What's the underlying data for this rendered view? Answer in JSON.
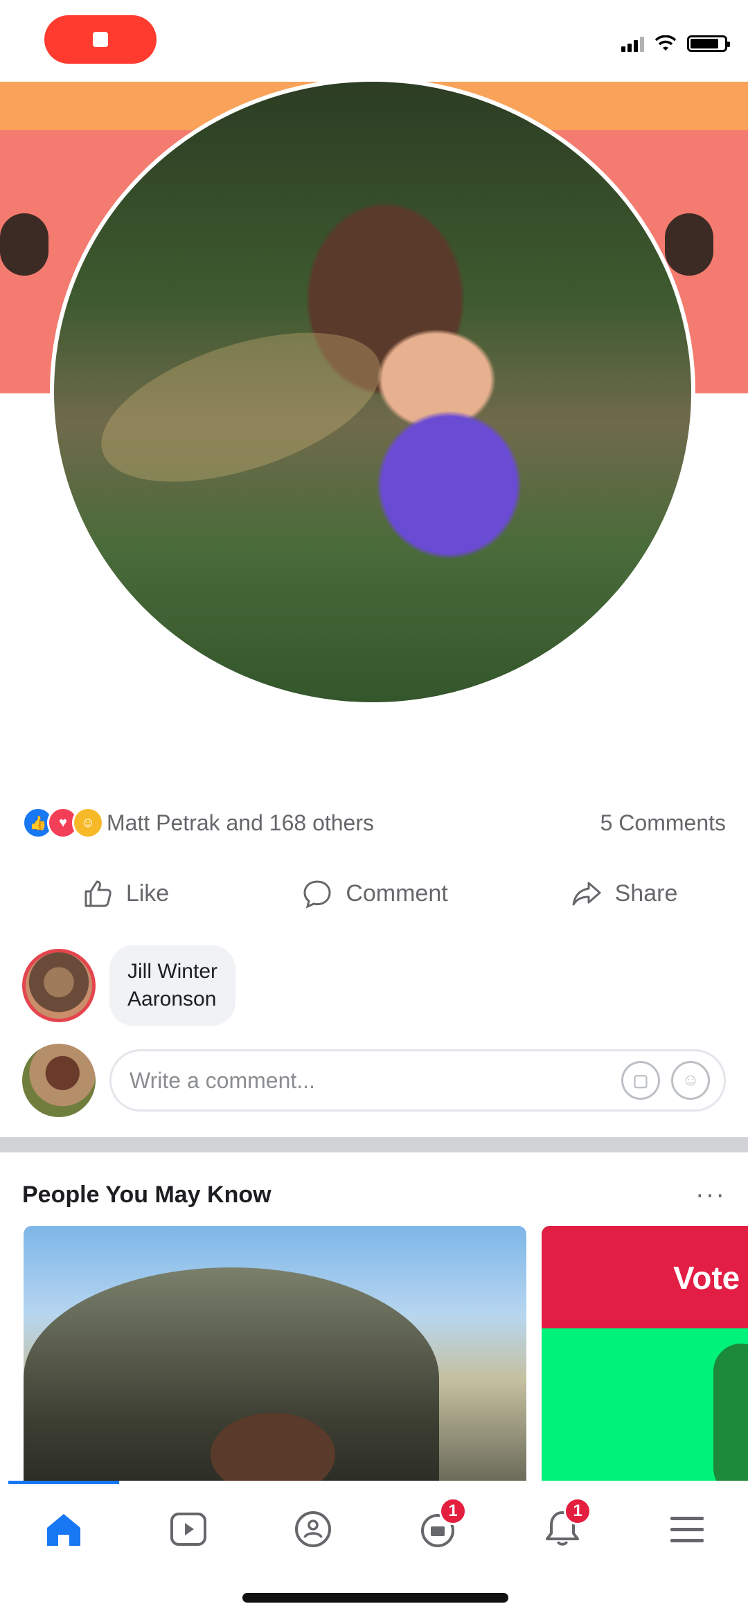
{
  "colors": {
    "accent": "#1877f2",
    "record": "#ff3b30",
    "badge": "#e41e3f",
    "muted_text": "#65676b",
    "bubble": "#f0f2f5"
  },
  "post": {
    "reactions_text": "Matt Petrak and 168 others",
    "comments_count": "5 Comments",
    "reaction_icons": [
      "like",
      "love",
      "care"
    ]
  },
  "actions": {
    "like": "Like",
    "comment": "Comment",
    "share": "Share"
  },
  "comment": {
    "author_line1": "Jill Winter",
    "author_line2": "Aaronson"
  },
  "write_comment": {
    "placeholder": "Write a comment..."
  },
  "pymk": {
    "title": "People You May Know",
    "more": "···",
    "card2_text": "Vote"
  },
  "nav": {
    "items": [
      "home",
      "watch",
      "groups",
      "marketplace",
      "notifications",
      "menu"
    ],
    "marketplace_badge": "1",
    "notifications_badge": "1"
  }
}
